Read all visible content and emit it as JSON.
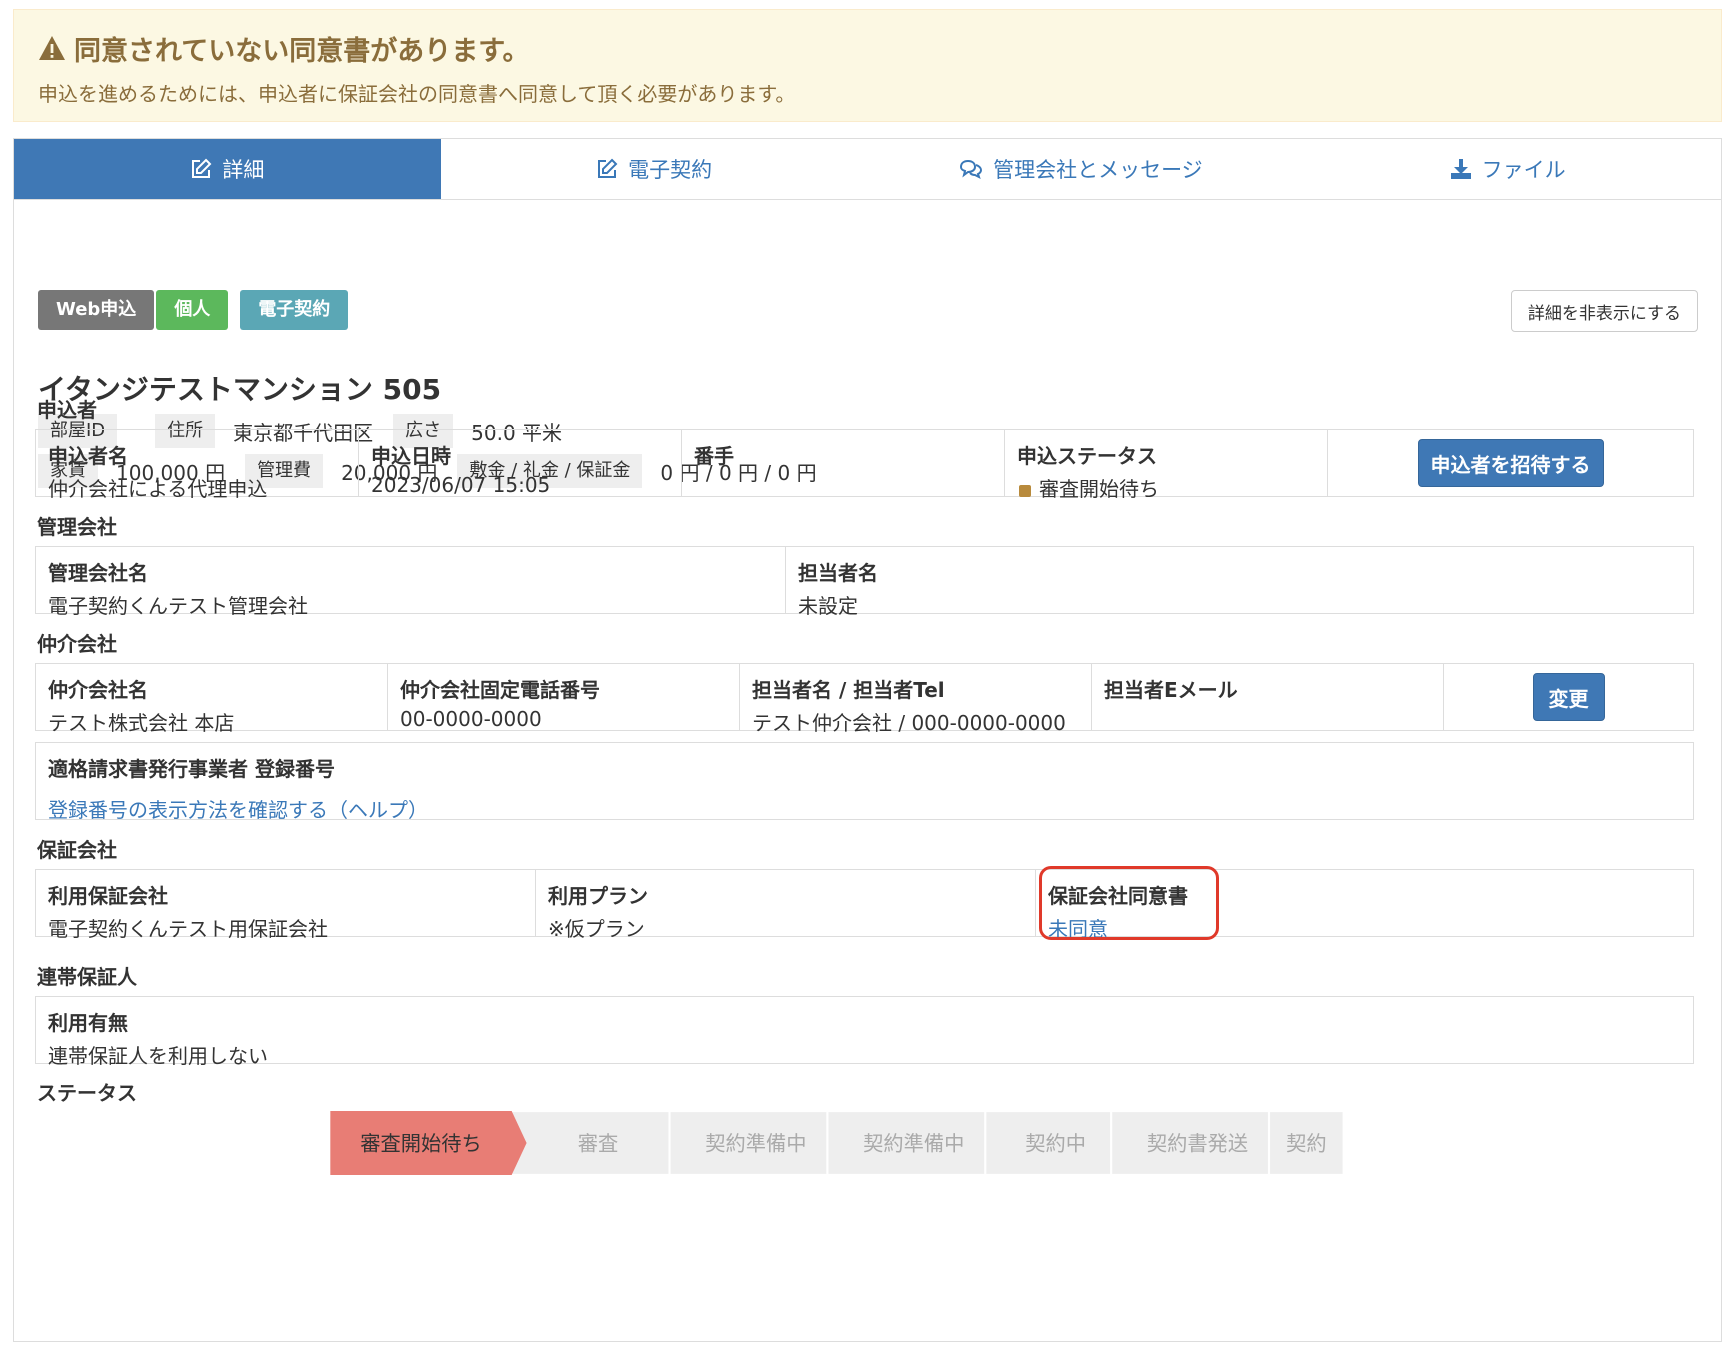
{
  "alert": {
    "title": "同意されていない同意書があります。",
    "body": "申込を進めるためには、申込者に保証会社の同意書へ同意して頂く必要があります。"
  },
  "tabs": [
    {
      "label": "詳細",
      "icon": "edit-icon"
    },
    {
      "label": "電子契約",
      "icon": "edit-icon"
    },
    {
      "label": "管理会社とメッセージ",
      "icon": "chat-icon"
    },
    {
      "label": "ファイル",
      "icon": "download-icon"
    }
  ],
  "badges": [
    "Web申込",
    "個人",
    "電子契約"
  ],
  "hide_detail_button": "詳細を非表示にする",
  "property": {
    "title": "イタンジテストマンション 505",
    "room_id_label": "部屋ID",
    "room_id_value": "",
    "address_label": "住所",
    "address_value": "東京都千代田区",
    "area_label": "広さ",
    "area_value": "50.0 平米",
    "rent_label": "家賃",
    "rent_value": "100,000 円",
    "fee_label": "管理費",
    "fee_value": "20,000 円",
    "deposit_label": "敷金 / 礼金 / 保証金",
    "deposit_value": "0 円 / 0 円 / 0 円"
  },
  "applicant": {
    "section": "申込者",
    "name_label": "申込者名",
    "name_value": "仲介会社による代理申込",
    "date_label": "申込日時",
    "date_value": "2023/06/07 15:05",
    "number_label": "番手",
    "number_value": "",
    "status_label": "申込ステータス",
    "status_value": "審査開始待ち",
    "invite_button": "申込者を招待する"
  },
  "management": {
    "section": "管理会社",
    "company_label": "管理会社名",
    "company_value": "電子契約くんテスト管理会社",
    "person_label": "担当者名",
    "person_value": "未設定"
  },
  "broker": {
    "section": "仲介会社",
    "company_label": "仲介会社名",
    "company_value": "テスト株式会社 本店",
    "phone_label": "仲介会社固定電話番号",
    "phone_value": "00-0000-0000",
    "person_label": "担当者名 / 担当者Tel",
    "person_value": "テスト仲介会社 / 000-0000-0000",
    "email_label": "担当者Eメール",
    "email_value": "",
    "change_button": "変更",
    "invoice_label": "適格請求書発行事業者 登録番号",
    "invoice_link": "登録番号の表示方法を確認する（ヘルプ）"
  },
  "guarantor_company": {
    "section": "保証会社",
    "company_label": "利用保証会社",
    "company_value": "電子契約くんテスト用保証会社",
    "plan_label": "利用プラン",
    "plan_value": "※仮プラン",
    "consent_label": "保証会社同意書",
    "consent_value": "未同意"
  },
  "joint_guarantor": {
    "section": "連帯保証人",
    "use_label": "利用有無",
    "use_value": "連帯保証人を利用しない"
  },
  "status_section": {
    "section": "ステータス",
    "steps": [
      "審査開始待ち",
      "審査",
      "契約準備中",
      "契約準備中",
      "契約中",
      "契約書発送",
      "契約"
    ],
    "active_index": 0
  },
  "colors": {
    "primary": "#3f78b5",
    "alert_text": "#8a6d3b",
    "alert_bg": "#fcf8e3",
    "active_step": "#e87d75",
    "inactive_step": "#eeeeee",
    "highlight": "#e0392a"
  }
}
